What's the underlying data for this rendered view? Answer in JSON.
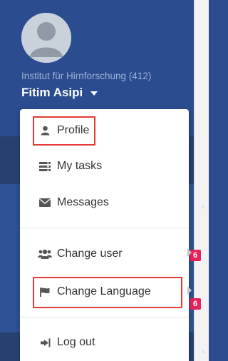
{
  "user": {
    "institute": "Institut für Hirnforschung (412)",
    "name": "Fitim Asipi"
  },
  "menu": {
    "profile": "Profile",
    "my_tasks": "My tasks",
    "messages": "Messages",
    "change_user": "Change user",
    "change_language": "Change Language",
    "log_out": "Log out"
  },
  "badges": {
    "badge_1": "6",
    "badge_2": "6"
  },
  "icons": {
    "profile": "user-icon",
    "my_tasks": "tasks-icon",
    "messages": "envelope-icon",
    "change_user": "users-icon",
    "change_language": "flag-icon",
    "log_out": "sign-out-icon",
    "submenu": "chevron-right-icon",
    "collapse": "chevron-left-icon"
  },
  "colors": {
    "sidebar_bg": "#2b4c8f",
    "dropdown_bg": "#ffffff",
    "badge": "#e8225a",
    "highlight": "#e53935"
  }
}
